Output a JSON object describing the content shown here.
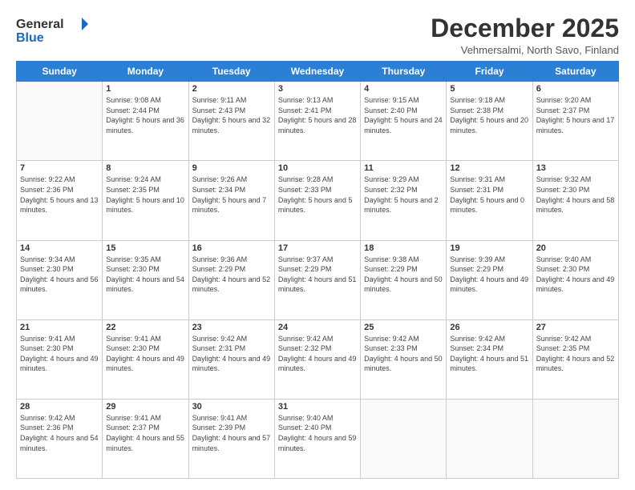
{
  "header": {
    "logo_general": "General",
    "logo_blue": "Blue",
    "month_title": "December 2025",
    "subtitle": "Vehmersalmi, North Savo, Finland"
  },
  "days_of_week": [
    "Sunday",
    "Monday",
    "Tuesday",
    "Wednesday",
    "Thursday",
    "Friday",
    "Saturday"
  ],
  "weeks": [
    [
      {
        "day": "",
        "info": ""
      },
      {
        "day": "1",
        "info": "Sunrise: 9:08 AM\nSunset: 2:44 PM\nDaylight: 5 hours\nand 36 minutes."
      },
      {
        "day": "2",
        "info": "Sunrise: 9:11 AM\nSunset: 2:43 PM\nDaylight: 5 hours\nand 32 minutes."
      },
      {
        "day": "3",
        "info": "Sunrise: 9:13 AM\nSunset: 2:41 PM\nDaylight: 5 hours\nand 28 minutes."
      },
      {
        "day": "4",
        "info": "Sunrise: 9:15 AM\nSunset: 2:40 PM\nDaylight: 5 hours\nand 24 minutes."
      },
      {
        "day": "5",
        "info": "Sunrise: 9:18 AM\nSunset: 2:38 PM\nDaylight: 5 hours\nand 20 minutes."
      },
      {
        "day": "6",
        "info": "Sunrise: 9:20 AM\nSunset: 2:37 PM\nDaylight: 5 hours\nand 17 minutes."
      }
    ],
    [
      {
        "day": "7",
        "info": "Sunrise: 9:22 AM\nSunset: 2:36 PM\nDaylight: 5 hours\nand 13 minutes."
      },
      {
        "day": "8",
        "info": "Sunrise: 9:24 AM\nSunset: 2:35 PM\nDaylight: 5 hours\nand 10 minutes."
      },
      {
        "day": "9",
        "info": "Sunrise: 9:26 AM\nSunset: 2:34 PM\nDaylight: 5 hours\nand 7 minutes."
      },
      {
        "day": "10",
        "info": "Sunrise: 9:28 AM\nSunset: 2:33 PM\nDaylight: 5 hours\nand 5 minutes."
      },
      {
        "day": "11",
        "info": "Sunrise: 9:29 AM\nSunset: 2:32 PM\nDaylight: 5 hours\nand 2 minutes."
      },
      {
        "day": "12",
        "info": "Sunrise: 9:31 AM\nSunset: 2:31 PM\nDaylight: 5 hours\nand 0 minutes."
      },
      {
        "day": "13",
        "info": "Sunrise: 9:32 AM\nSunset: 2:30 PM\nDaylight: 4 hours\nand 58 minutes."
      }
    ],
    [
      {
        "day": "14",
        "info": "Sunrise: 9:34 AM\nSunset: 2:30 PM\nDaylight: 4 hours\nand 56 minutes."
      },
      {
        "day": "15",
        "info": "Sunrise: 9:35 AM\nSunset: 2:30 PM\nDaylight: 4 hours\nand 54 minutes."
      },
      {
        "day": "16",
        "info": "Sunrise: 9:36 AM\nSunset: 2:29 PM\nDaylight: 4 hours\nand 52 minutes."
      },
      {
        "day": "17",
        "info": "Sunrise: 9:37 AM\nSunset: 2:29 PM\nDaylight: 4 hours\nand 51 minutes."
      },
      {
        "day": "18",
        "info": "Sunrise: 9:38 AM\nSunset: 2:29 PM\nDaylight: 4 hours\nand 50 minutes."
      },
      {
        "day": "19",
        "info": "Sunrise: 9:39 AM\nSunset: 2:29 PM\nDaylight: 4 hours\nand 49 minutes."
      },
      {
        "day": "20",
        "info": "Sunrise: 9:40 AM\nSunset: 2:30 PM\nDaylight: 4 hours\nand 49 minutes."
      }
    ],
    [
      {
        "day": "21",
        "info": "Sunrise: 9:41 AM\nSunset: 2:30 PM\nDaylight: 4 hours\nand 49 minutes."
      },
      {
        "day": "22",
        "info": "Sunrise: 9:41 AM\nSunset: 2:30 PM\nDaylight: 4 hours\nand 49 minutes."
      },
      {
        "day": "23",
        "info": "Sunrise: 9:42 AM\nSunset: 2:31 PM\nDaylight: 4 hours\nand 49 minutes."
      },
      {
        "day": "24",
        "info": "Sunrise: 9:42 AM\nSunset: 2:32 PM\nDaylight: 4 hours\nand 49 minutes."
      },
      {
        "day": "25",
        "info": "Sunrise: 9:42 AM\nSunset: 2:33 PM\nDaylight: 4 hours\nand 50 minutes."
      },
      {
        "day": "26",
        "info": "Sunrise: 9:42 AM\nSunset: 2:34 PM\nDaylight: 4 hours\nand 51 minutes."
      },
      {
        "day": "27",
        "info": "Sunrise: 9:42 AM\nSunset: 2:35 PM\nDaylight: 4 hours\nand 52 minutes."
      }
    ],
    [
      {
        "day": "28",
        "info": "Sunrise: 9:42 AM\nSunset: 2:36 PM\nDaylight: 4 hours\nand 54 minutes."
      },
      {
        "day": "29",
        "info": "Sunrise: 9:41 AM\nSunset: 2:37 PM\nDaylight: 4 hours\nand 55 minutes."
      },
      {
        "day": "30",
        "info": "Sunrise: 9:41 AM\nSunset: 2:39 PM\nDaylight: 4 hours\nand 57 minutes."
      },
      {
        "day": "31",
        "info": "Sunrise: 9:40 AM\nSunset: 2:40 PM\nDaylight: 4 hours\nand 59 minutes."
      },
      {
        "day": "",
        "info": ""
      },
      {
        "day": "",
        "info": ""
      },
      {
        "day": "",
        "info": ""
      }
    ]
  ]
}
